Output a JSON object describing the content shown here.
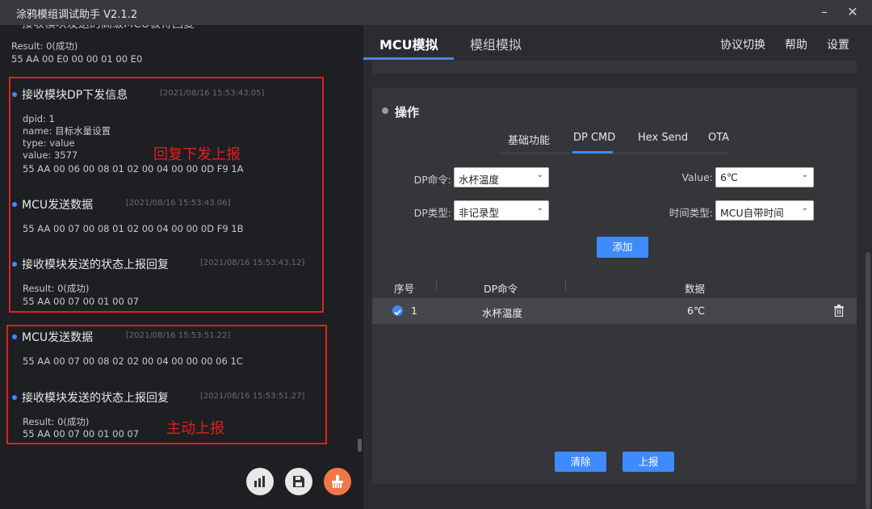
{
  "window": {
    "title": "涂鸦模组调试助手 V2.1.2",
    "minimize_icon": "minimize-icon",
    "close_icon": "close-icon"
  },
  "log": {
    "top_partial_title": "接收模块发送的高级MCU板得回复",
    "entries": [
      {
        "title": "",
        "time": "",
        "lines": [
          "Result: 0(成功)",
          "55 AA 00 E0 00 00 01 00 E0"
        ]
      },
      {
        "title": "接收模块DP下发信息",
        "time": "[2021/08/16 15:53:43.05]",
        "lines": [
          "dpid: 1",
          "name: 目标水量设置",
          "type: value",
          "value: 3577",
          "55 AA 00 06 00 08 01 02 00 04 00 00 0D F9 1A"
        ]
      },
      {
        "title": "MCU发送数据",
        "time": "[2021/08/16 15:53:43.06]",
        "lines": [
          "55 AA 00 07 00 08 01 02 00 04 00 00 0D F9 1B"
        ]
      },
      {
        "title": "接收模块发送的状态上报回复",
        "time": "[2021/08/16 15:53:43.12]",
        "lines": [
          "Result: 0(成功)",
          "55 AA 00 07 00 01 00 07"
        ]
      },
      {
        "title": "MCU发送数据",
        "time": "[2021/08/16 15:53:51.22]",
        "lines": [
          "55 AA 00 07 00 08 02 02 00 04 00 00 00 06 1C"
        ]
      },
      {
        "title": "接收模块发送的状态上报回复",
        "time": "[2021/08/16 15:53:51.27]",
        "lines": [
          "Result: 0(成功)",
          "55 AA 00 07 00 01 00 07"
        ]
      }
    ],
    "annotations": {
      "reply_label": "回复下发上报",
      "active_label": "主动上报",
      "color": "#e02020"
    },
    "bottom_buttons": [
      {
        "icon": "bar-chart-icon"
      },
      {
        "icon": "save-icon"
      },
      {
        "icon": "clear-log-icon",
        "color": "#f07848"
      }
    ]
  },
  "tabs": {
    "mcu": "MCU模拟",
    "module": "模组模拟",
    "active": "MCU模拟"
  },
  "menu": {
    "protocol": "协议切换",
    "help": "帮助",
    "settings": "设置"
  },
  "panel": {
    "title": "操作",
    "sub_tabs": [
      "基础功能",
      "DP CMD",
      "Hex Send",
      "OTA"
    ],
    "active_sub_tab": "DP CMD",
    "form": {
      "dp_cmd_label": "DP命令:",
      "dp_cmd_value": "水杯温度",
      "value_label": "Value:",
      "value_value": "6℃",
      "dp_type_label": "DP类型:",
      "dp_type_value": "非记录型",
      "time_type_label": "时间类型:",
      "time_type_value": "MCU自带时间"
    },
    "add_button": "添加",
    "table": {
      "headers": [
        "序号",
        "DP命令",
        "数据"
      ],
      "rows": [
        {
          "index": "1",
          "cmd": "水杯温度",
          "data": "6℃",
          "checked": true
        }
      ]
    },
    "clear_button": "清除",
    "report_button": "上报"
  },
  "colors": {
    "accent": "#3e8bff",
    "background": "#1e1f22",
    "panel": "#35363a"
  }
}
